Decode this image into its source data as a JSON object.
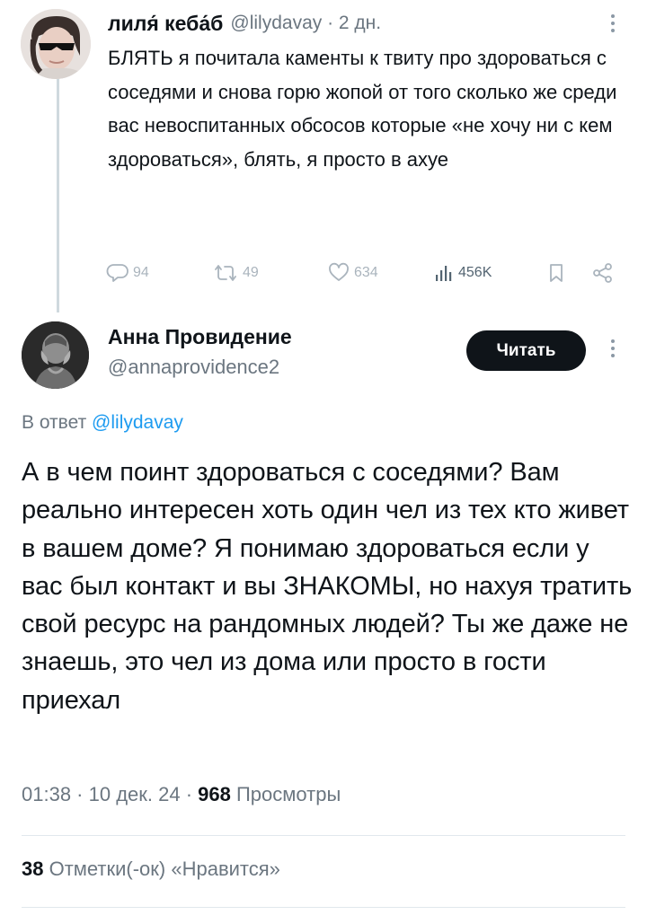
{
  "parent_tweet": {
    "author_name": "лиля́ кеба́б",
    "meta": "@lilydavay · 2 дн.",
    "text": "БЛЯТЬ я почитала каменты к твиту про здороваться с соседями и снова горю жопой от того сколько же среди вас невоспитанных обсосов которые «не хочу ни с кем здороваться», блять, я просто в ахуе",
    "actions": {
      "replies": "94",
      "retweets": "49",
      "likes": "634",
      "views": "456K"
    },
    "icons": [
      "reply-icon",
      "retweet-icon",
      "like-icon",
      "views-icon",
      "bookmark-icon",
      "share-icon",
      "more-icon"
    ]
  },
  "main_tweet": {
    "author_name": "Анна Провидение",
    "handle": "@annaprovidence2",
    "follow_label": "Читать",
    "reply_prefix": "В ответ",
    "reply_handle": "@lilydavay",
    "text": "А в чем поинт здороваться с соседями? Вам реально интересен хоть один чел из тех кто живет в вашем доме? Я понимаю здороваться если у вас был контакт и вы ЗНАКОМЫ, но нахуя тратить свой ресурс на рандомных людей? Ты же даже не знаешь, это чел из дома или просто в гости приехал",
    "time": "01:38 · 10 дек. 24 · ",
    "views_count": "968",
    "views_label": " Просмотры",
    "likes_count": "38",
    "likes_label": " Отметки(-ок) «Нравится»"
  },
  "colors": {
    "text": "#0f1419",
    "secondary": "#6b7680",
    "link": "#1d9bf0",
    "action_icons": "#aab4bd",
    "thread_line": "#cfd9de",
    "button_bg": "#0f1419"
  }
}
